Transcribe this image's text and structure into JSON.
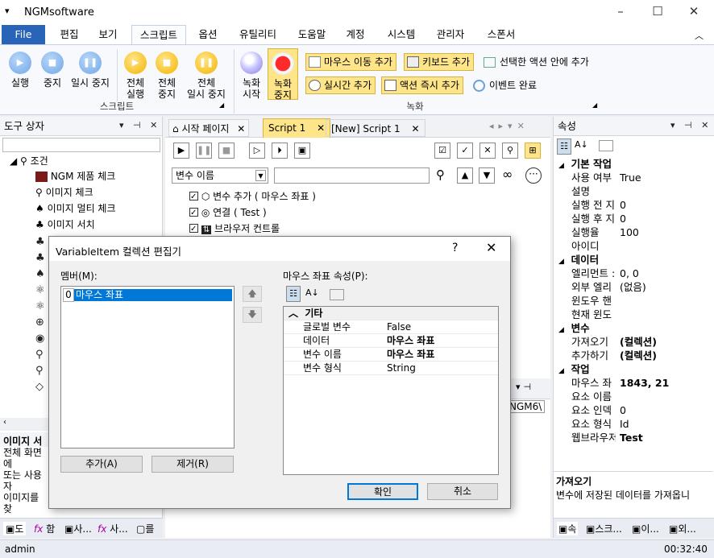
{
  "window": {
    "title": "NGMsoftware",
    "controls": [
      "–",
      "☐",
      "✕"
    ]
  },
  "menu": {
    "file": "File",
    "items": [
      "편집",
      "보기",
      "스크립트",
      "옵션",
      "유틸리티",
      "도움말",
      "계정",
      "시스템",
      "관리자",
      "스폰서"
    ]
  },
  "ribbon": {
    "run_buttons": [
      "실행",
      "중지",
      "일시 중지"
    ],
    "all_buttons": [
      [
        "전체",
        "실행"
      ],
      [
        "전체",
        "중지"
      ],
      [
        "전체",
        "일시 중지"
      ]
    ],
    "script_group": "스크립트",
    "record_buttons": [
      [
        "녹화",
        "시작"
      ],
      [
        "녹화",
        "중지"
      ]
    ],
    "record_group": "녹화",
    "small_buttons": [
      "마우스 이동 추가",
      "키보드 추가",
      "실시간 추가",
      "액션 즉시 추가"
    ],
    "plain_buttons": [
      "선택한 액션 안에 추가",
      "이벤트 완료"
    ]
  },
  "toolbox": {
    "title": "도구 상자",
    "root": "조건",
    "items": [
      "NGM 제품 체크",
      "이미지 체크",
      "이미지 멀티 체크",
      "이미지 서치"
    ],
    "desc_title": "이미지 서",
    "desc": [
      "전체 화면에",
      "또는 사용자",
      "이미지를 찾"
    ],
    "bottom_tabs": [
      "도",
      "함",
      "사...",
      "사...",
      "를"
    ]
  },
  "tabs": {
    "start": "시작 페이지",
    "script1": "Script 1",
    "new_script": "[New] Script 1"
  },
  "editor": {
    "var_select": "변수 이름",
    "actions": [
      "변수 추가 ( 마우스 좌표 )",
      "연결 ( Test )",
      "브라우저 컨트롤"
    ],
    "partial_tab": "NGM6\\"
  },
  "dialog": {
    "title": "VariableItem 컬렉션 편집기",
    "help": "?",
    "members_label": "멤버(M):",
    "member_index": "0",
    "member_name": "마우스 좌표",
    "props_label": "마우스 좌표 속성(P):",
    "category": "기타",
    "props": [
      {
        "k": "글로벌 변수",
        "v": "False",
        "bold": false
      },
      {
        "k": "데이터",
        "v": "마우스 좌표",
        "bold": true
      },
      {
        "k": "변수 이름",
        "v": "마우스 좌표",
        "bold": true
      },
      {
        "k": "변수 형식",
        "v": "String",
        "bold": false
      }
    ],
    "add": "추가(A)",
    "remove": "제거(R)",
    "ok": "확인",
    "cancel": "취소"
  },
  "properties": {
    "title": "속성",
    "sections": [
      {
        "name": "기본 작업",
        "rows": [
          [
            "사용 여부",
            "True"
          ],
          [
            "설명",
            ""
          ],
          [
            "실행 전 지",
            "0"
          ],
          [
            "실행 후 지",
            "0"
          ],
          [
            "실행율",
            "100"
          ],
          [
            "아이디",
            ""
          ]
        ]
      },
      {
        "name": "데이터",
        "rows": [
          [
            "엘리먼트 :",
            "0, 0"
          ],
          [
            "외부 엘리",
            "(없음)"
          ],
          [
            "윈도우 핸",
            ""
          ],
          [
            "현재 윈도",
            ""
          ]
        ]
      },
      {
        "name": "변수",
        "rows": [
          [
            "가져오기",
            "(컬렉션)"
          ],
          [
            "추가하기",
            "(컬렉션)"
          ]
        ]
      },
      {
        "name": "작업",
        "rows": [
          [
            "마우스 좌",
            "1843, 21"
          ],
          [
            "요소 이름",
            ""
          ],
          [
            "요소 인덱",
            "0"
          ],
          [
            "요소 형식",
            "Id"
          ],
          [
            "웹브라우저",
            "Test"
          ]
        ]
      }
    ],
    "desc_title": "가져오기",
    "desc": "변수에 저장된 데이터를 가져옵니",
    "bottom_tabs": [
      "속",
      "스크...",
      "이...",
      "외..."
    ]
  },
  "status": {
    "user": "admin",
    "time": "00:32:40"
  }
}
